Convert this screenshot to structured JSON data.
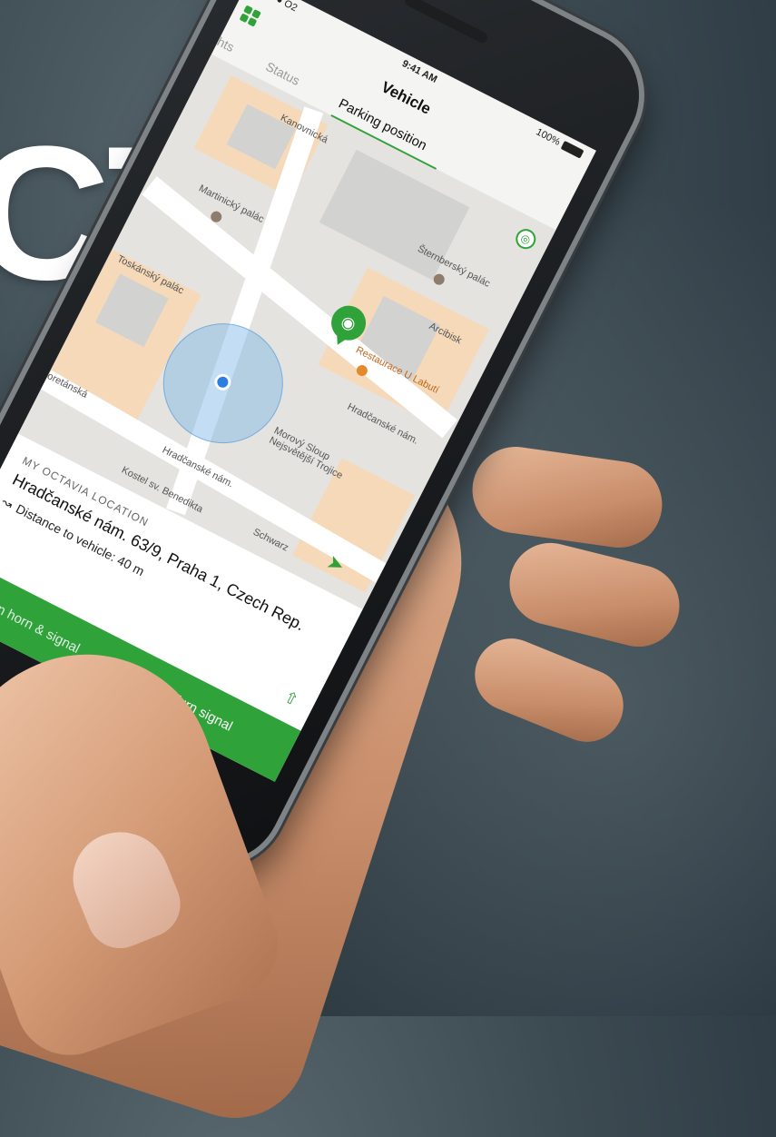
{
  "headline": "CT",
  "phone": {
    "status_bar": {
      "carrier": "●●●●● O2",
      "time": "9:41 AM",
      "battery": "100%"
    },
    "app": {
      "title": "Vehicle",
      "tabs": [
        {
          "label": "ghts"
        },
        {
          "label": "Status"
        },
        {
          "label": "Parking position",
          "active": true
        }
      ],
      "map": {
        "labels": {
          "martinicky": "Martinický palác",
          "sternbersky": "Šternberský palác",
          "arcibisk": "Arcibisk",
          "restaurace": "Restaurace U Labutí",
          "hradcanske1": "Hradčanské nám.",
          "toskansky": "Toskánský palác",
          "morovy": "Morový Sloup Nejsvětější Trojice",
          "hradcanske2": "Hradčanské nám.",
          "loretanska": "oretánská",
          "kostel": "Kostel sv. Benedikta",
          "schwarz": "Schwarz",
          "street_top": "Kanovnická"
        }
      },
      "location_card": {
        "caption": "MY OCTAVIA LOCATION",
        "address": "Hradčanské nám. 63/9, Praha 1, Czech Rep.",
        "distance": "Distance to vehicle: 40 m"
      },
      "actions": {
        "left": "Turn horn & signal",
        "right": "Turn signal"
      }
    }
  },
  "colors": {
    "accent": "#2fa23a",
    "location": "#2a7de1"
  },
  "icons": [
    "grid-icon",
    "layers-icon",
    "car-pin-icon",
    "location-dot-icon",
    "navigation-arrow-icon",
    "share-icon",
    "route-icon",
    "battery-icon"
  ]
}
